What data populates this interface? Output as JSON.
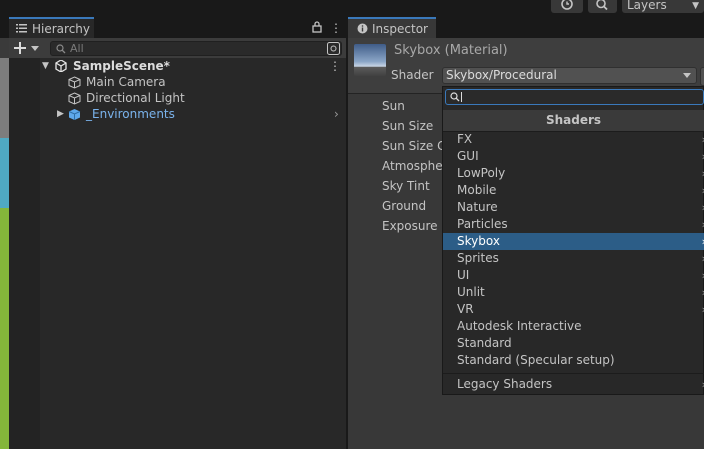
{
  "toolbar": {
    "layers_label": "Layers"
  },
  "hierarchy": {
    "tab_label": "Hierarchy",
    "search_placeholder": "All",
    "scene_name": "SampleScene*",
    "items": [
      {
        "label": "Main Camera"
      },
      {
        "label": "Directional Light"
      },
      {
        "label": "_Environments"
      }
    ]
  },
  "inspector": {
    "tab_label": "Inspector",
    "material_name": "Skybox (Material)",
    "shader_label": "Shader",
    "shader_value": "Skybox/Procedural",
    "properties": [
      "Sun",
      "Sun Size",
      "Sun Size C",
      "Atmospher",
      "Sky Tint",
      "Ground",
      "Exposure"
    ]
  },
  "shader_popup": {
    "search_value": "",
    "title": "Shaders",
    "items": [
      {
        "label": "FX",
        "submenu": true
      },
      {
        "label": "GUI",
        "submenu": true
      },
      {
        "label": "LowPoly",
        "submenu": true
      },
      {
        "label": "Mobile",
        "submenu": true
      },
      {
        "label": "Nature",
        "submenu": true
      },
      {
        "label": "Particles",
        "submenu": true
      },
      {
        "label": "Skybox",
        "submenu": true,
        "selected": true
      },
      {
        "label": "Sprites",
        "submenu": true
      },
      {
        "label": "UI",
        "submenu": true
      },
      {
        "label": "Unlit",
        "submenu": true
      },
      {
        "label": "VR",
        "submenu": true
      },
      {
        "label": "Autodesk Interactive",
        "submenu": false
      },
      {
        "label": "Standard",
        "submenu": false
      },
      {
        "label": "Standard (Specular setup)",
        "submenu": false
      }
    ],
    "legacy_label": "Legacy Shaders"
  },
  "colors": {
    "accent": "#3a79bb",
    "selection": "#2c5d87",
    "prefab_blue": "#7ab3ec"
  }
}
